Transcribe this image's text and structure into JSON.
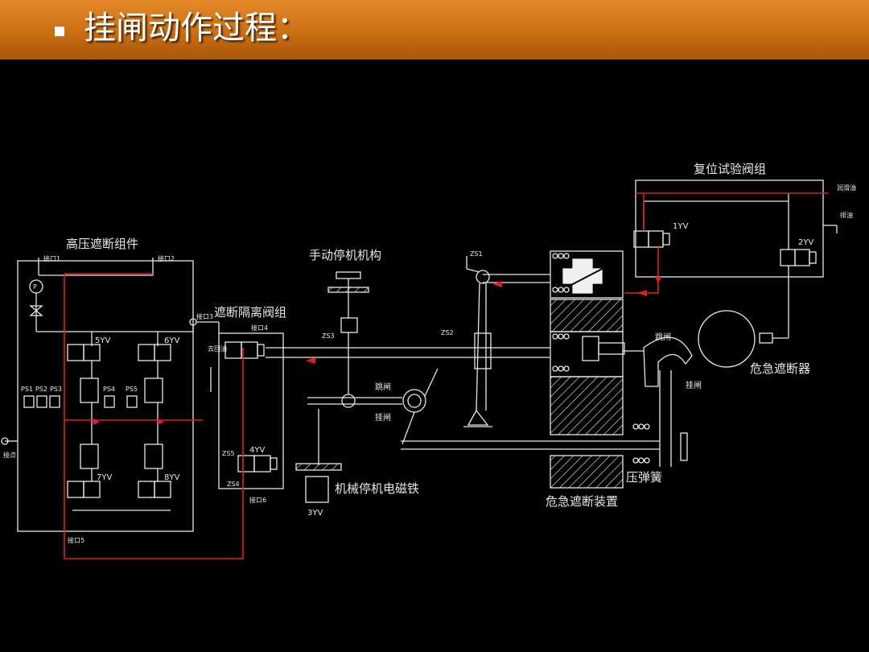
{
  "slide": {
    "title": "挂闸动作过程："
  },
  "labels": {
    "reset_test_valve_group": "复位试验阀组",
    "hp_trip_assembly": "高压遮断组件",
    "manual_stop": "手动停机机构",
    "isolation_valve_group": "遮断隔离阀组",
    "emergency_trip": "危急遮断器",
    "mech_stop_solenoid": "机械停机电磁铁",
    "emergency_trip_device": "危急遮断装置",
    "compression_spring": "压弹簧",
    "trip_top": "跳闸",
    "latch_top": "挂闸",
    "trip_right": "跳闸",
    "latch_right": "挂闸",
    "to_oil": "去回油",
    "lube_oil": "润滑油",
    "drain": "排油",
    "port1": "接口1",
    "port2": "接口2",
    "port3": "接口3",
    "port4": "接口4",
    "port5": "接口5",
    "port6": "接口6",
    "port_a": "接点"
  },
  "components": {
    "yv1": "1YV",
    "yv2": "2YV",
    "yv3": "3YV",
    "yv4": "4YV",
    "yv5": "5YV",
    "yv6": "6YV",
    "yv7": "7YV",
    "yv8": "8YV",
    "zs1": "ZS1",
    "zs2": "ZS2",
    "zs3": "ZS3",
    "zs4": "ZS4",
    "zs5": "ZS5",
    "ps1": "PS1",
    "ps2": "PS2",
    "ps3": "PS3",
    "ps4": "PS4",
    "ps5": "PS5",
    "p": "P"
  },
  "colors": {
    "title_bar": "#c96f14",
    "line": "#e8e8e8",
    "oil_red": "#e01e1e",
    "background": "#000000"
  }
}
